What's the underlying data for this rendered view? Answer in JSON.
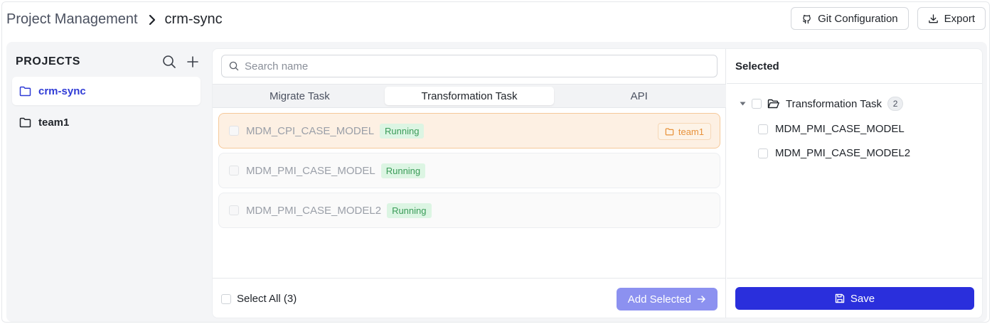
{
  "breadcrumb": {
    "root": "Project Management",
    "current": "crm-sync"
  },
  "header_actions": {
    "git_label": "Git Configuration",
    "export_label": "Export"
  },
  "sidebar": {
    "title": "PROJECTS",
    "projects": [
      {
        "label": "crm-sync",
        "active": true
      },
      {
        "label": "team1",
        "active": false
      }
    ]
  },
  "search": {
    "placeholder": "Search name",
    "value": ""
  },
  "tabs": [
    {
      "label": "Migrate Task",
      "active": false
    },
    {
      "label": "Transformation Task",
      "active": true
    },
    {
      "label": "API",
      "active": false
    }
  ],
  "tasks": [
    {
      "name": "MDM_CPI_CASE_MODEL",
      "status": "Running",
      "project": "team1",
      "highlighted": true
    },
    {
      "name": "MDM_PMI_CASE_MODEL",
      "status": "Running",
      "highlighted": false
    },
    {
      "name": "MDM_PMI_CASE_MODEL2",
      "status": "Running",
      "highlighted": false
    }
  ],
  "footer": {
    "select_all_label": "Select All (3)",
    "add_selected_label": "Add Selected"
  },
  "selected_panel": {
    "title": "Selected",
    "group_label": "Transformation Task",
    "group_count": "2",
    "items": [
      "MDM_PMI_CASE_MODEL",
      "MDM_PMI_CASE_MODEL2"
    ],
    "save_label": "Save"
  },
  "colors": {
    "accent": "#2a2fdc",
    "active_project": "#2f3bd6",
    "running_text": "#3a9b58",
    "running_bg": "#dcf5e3",
    "highlight_bg": "#fdf0e3",
    "project_tag": "#e8923a"
  },
  "icons": {
    "header_separator": "chevron-right-icon",
    "git": "github-icon",
    "export": "download-icon",
    "sidebar_search": "search-icon",
    "sidebar_add": "plus-icon",
    "project": "folder-icon",
    "add_selected": "arrow-right-icon",
    "tree_toggle": "caret-down-icon",
    "tree_group": "folder-open-icon",
    "save": "save-icon"
  }
}
